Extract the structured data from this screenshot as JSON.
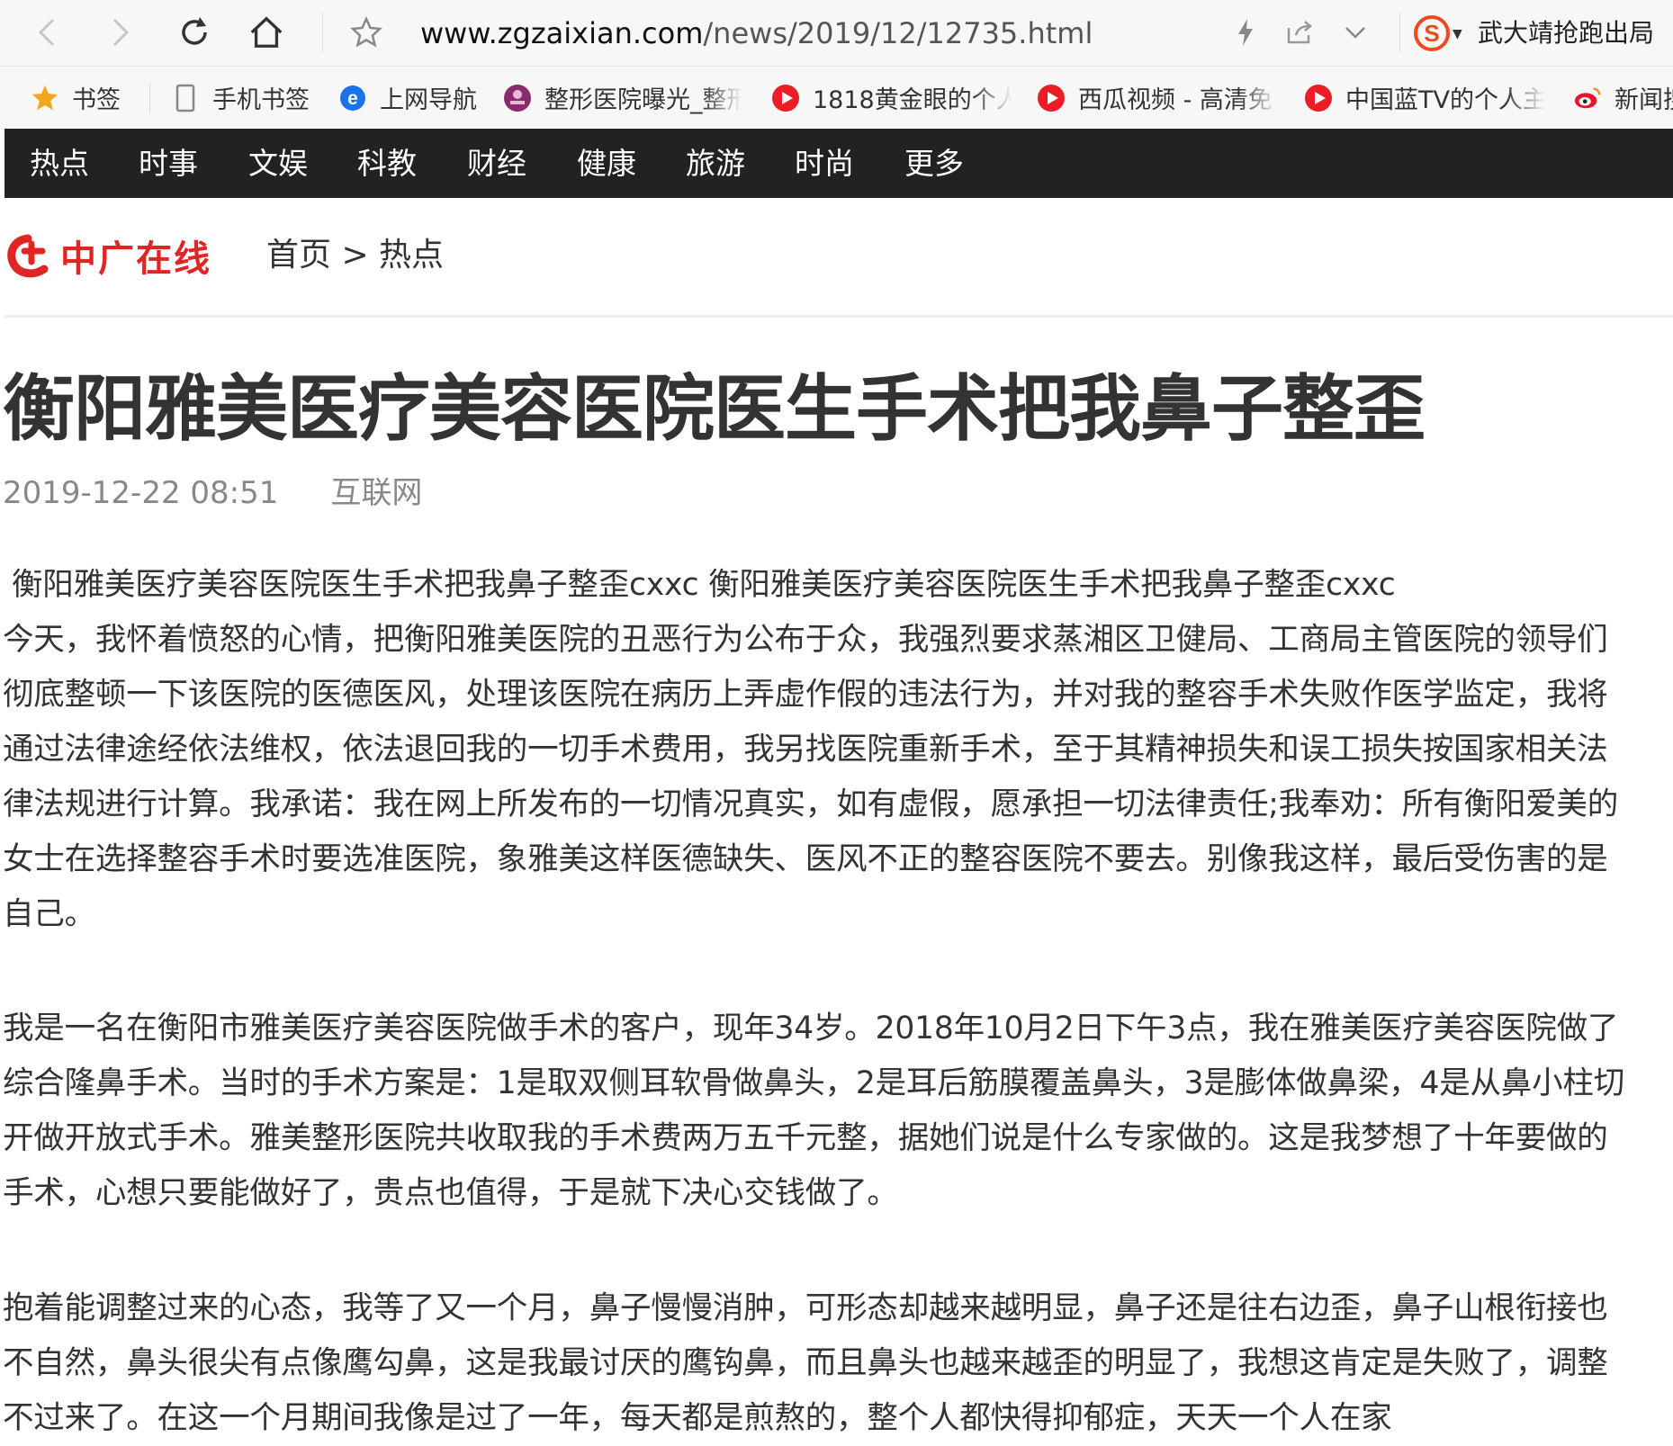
{
  "browser": {
    "url_host": "www.zgzaixian.com",
    "url_path": "/news/2019/12/12735.html",
    "news_button": "武大靖抢跑出局"
  },
  "bookmarks": [
    {
      "label": "书签",
      "icon": "star-icon"
    },
    {
      "label": "手机书签",
      "icon": "phone-icon"
    },
    {
      "label": "上网导航",
      "icon": "ie-icon"
    },
    {
      "label": "整形医院曝光_整形",
      "icon": "hospital-badge-icon"
    },
    {
      "label": "1818黄金眼的个人",
      "icon": "video-play-icon"
    },
    {
      "label": "西瓜视频 - 高清免",
      "icon": "video-play-icon"
    },
    {
      "label": "中国蓝TV的个人主",
      "icon": "video-play-icon"
    },
    {
      "label": "新闻搜",
      "icon": "weibo-icon"
    }
  ],
  "site_nav": [
    "热点",
    "时事",
    "文娱",
    "科教",
    "财经",
    "健康",
    "旅游",
    "时尚",
    "更多"
  ],
  "breadcrumb": "首页 > 热点",
  "article": {
    "title": "衡阳雅美医疗美容医院医生手术把我鼻子整歪",
    "date": "2019-12-22 08:51",
    "source": "互联网",
    "lead": "衡阳雅美医疗美容医院医生手术把我鼻子整歪cxxc 衡阳雅美医疗美容医院医生手术把我鼻子整歪cxxc",
    "paragraphs": [
      "今天，我怀着愤怒的心情，把衡阳雅美医院的丑恶行为公布于众，我强烈要求蒸湘区卫健局、工商局主管医院的领导们彻底整顿一下该医院的医德医风，处理该医院在病历上弄虚作假的违法行为，并对我的整容手术失败作医学监定，我将通过法律途经依法维权，依法退回我的一切手术费用，我另找医院重新手术，至于其精神损失和误工损失按国家相关法律法规进行计算。我承诺：我在网上所发布的一切情况真实，如有虚假，愿承担一切法律责任;我奉劝：所有衡阳爱美的女士在选择整容手术时要选准医院，象雅美这样医德缺失、医风不正的整容医院不要去。别像我这样，最后受伤害的是自己。",
      "我是一名在衡阳市雅美医疗美容医院做手术的客户，现年34岁。2018年10月2日下午3点，我在雅美医疗美容医院做了综合隆鼻手术。当时的手术方案是：1是取双侧耳软骨做鼻头，2是耳后筋膜覆盖鼻头，3是膨体做鼻梁，4是从鼻小柱切开做开放式手术。雅美整形医院共收取我的手术费两万五千元整，据她们说是什么专家做的。这是我梦想了十年要做的手术，心想只要能做好了，贵点也值得，于是就下决心交钱做了。",
      "抱着能调整过来的心态，我等了又一个月，鼻子慢慢消肿，可形态却越来越明显，鼻子还是往右边歪，鼻子山根衔接也不自然，鼻头很尖有点像鹰勾鼻，这是我最讨厌的鹰钩鼻，而且鼻头也越来越歪的明显了，我想这肯定是失败了，调整不过来了。在这一个月期间我像是过了一年，每天都是煎熬的，整个人都快得抑郁症，天天一个人在家"
    ]
  }
}
